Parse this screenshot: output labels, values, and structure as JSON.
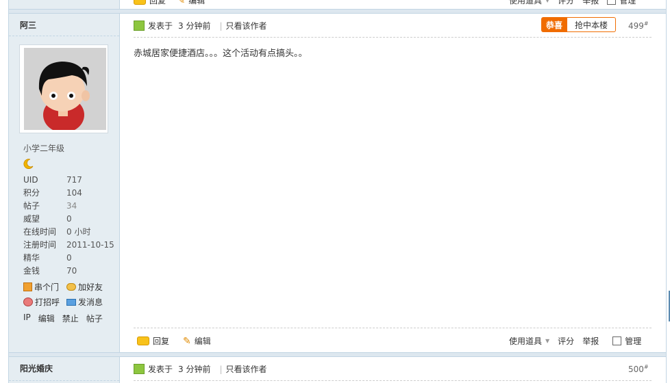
{
  "post": {
    "author": "阿三",
    "user_group": "小学二年级",
    "stats": [
      {
        "label": "UID",
        "value": "717"
      },
      {
        "label": "积分",
        "value": "104"
      },
      {
        "label": "帖子",
        "value": "34"
      },
      {
        "label": "威望",
        "value": "0"
      },
      {
        "label": "在线时间",
        "value": "0 小时"
      },
      {
        "label": "注册时间",
        "value": "2011-10-15"
      },
      {
        "label": "精华",
        "value": "0"
      },
      {
        "label": "金钱",
        "value": "70"
      }
    ],
    "user_links": {
      "visit": "串个门",
      "add_friend": "加好友",
      "greet": "打招呼",
      "message": "发消息"
    },
    "admin_links": [
      "IP",
      "编辑",
      "禁止",
      "帖子"
    ],
    "posted_prefix": "发表于",
    "posted_time": "3 分钟前",
    "only_author": "只看该作者",
    "floor_btn_primary": "恭喜",
    "floor_btn_secondary": "抢中本楼",
    "floor_no": "499",
    "content": "赤城居家便捷酒店。。。这个活动有点搞头。。",
    "actions": {
      "reply": "回复",
      "edit": "编辑",
      "use_tool": "使用道具",
      "rate": "评分",
      "report": "举报",
      "manage": "管理"
    }
  },
  "prev_post_actions": {
    "reply": "回复",
    "edit": "编辑",
    "use_tool": "使用道具",
    "rate": "评分",
    "report": "举报",
    "manage": "管理"
  },
  "next_post": {
    "author": "阳光婚庆",
    "posted_prefix": "发表于",
    "posted_time": "3 分钟前",
    "only_author": "只看该作者",
    "floor_no": "500"
  },
  "floor_mark": "#",
  "colors": {
    "accent_orange": "#f06c00",
    "sidebar_bg": "#e5edf2",
    "border": "#c2d5e3"
  }
}
